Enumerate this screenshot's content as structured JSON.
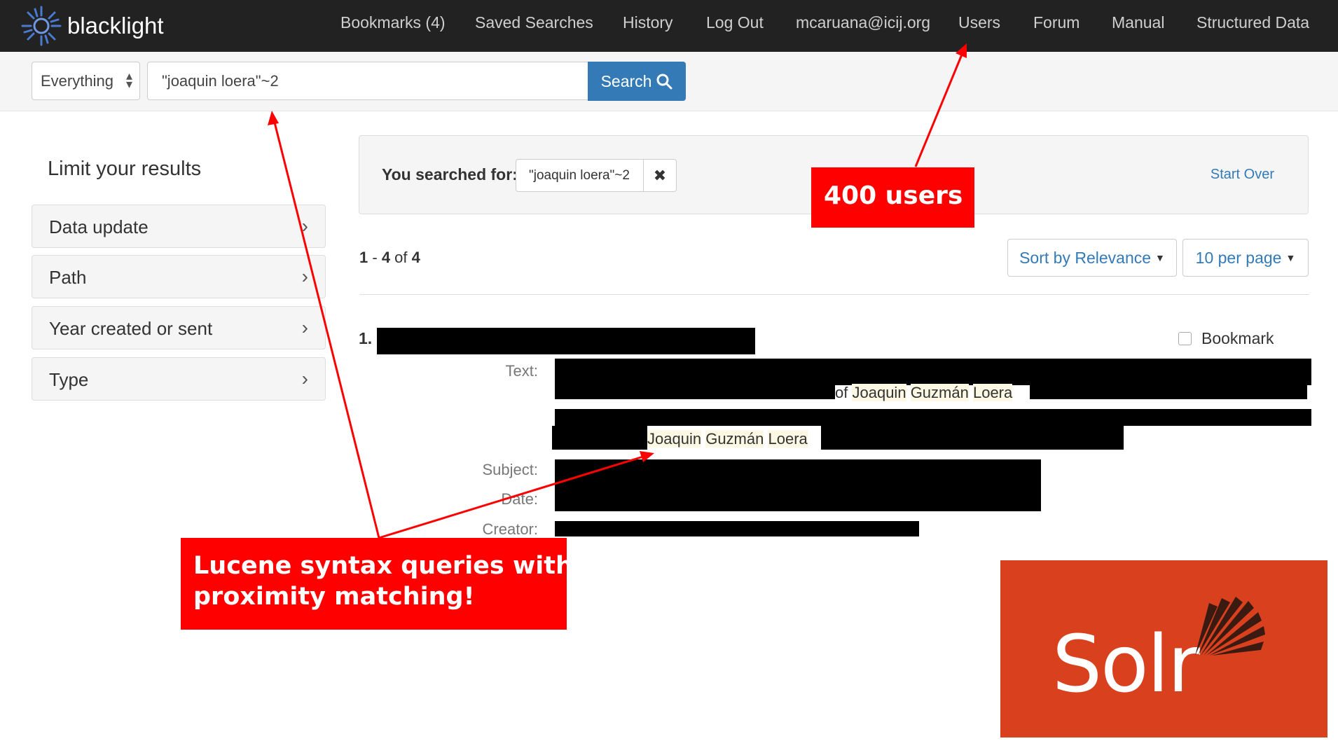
{
  "app": {
    "brand": "blacklight"
  },
  "nav": [
    "Bookmarks (4)",
    "Saved Searches",
    "History",
    "Log Out",
    "mcaruana@icij.org",
    "Users",
    "Forum",
    "Manual",
    "Structured Data"
  ],
  "search": {
    "scope": "Everything",
    "query": "\"joaquin loera\"~2",
    "button": "Search"
  },
  "sidebar": {
    "title": "Limit your results",
    "facets": [
      "Data update",
      "Path",
      "Year created or sent",
      "Type"
    ]
  },
  "constraints": {
    "label": "You searched for:",
    "value": "\"joaquin loera\"~2",
    "start_over": "Start Over"
  },
  "results": {
    "range_start": "1",
    "range_end": "4",
    "total": "4",
    "sort_label": "Sort by Relevance",
    "per_page_label": "10 per page",
    "doc_number": "1.",
    "bookmark_label": "Bookmark",
    "labels": {
      "text": "Text:",
      "subject": "Subject:",
      "date": "Date:",
      "creator": "Creator:"
    },
    "snippet1": {
      "pre": "of",
      "w1": "Joaquin",
      "w2": "Guzmán",
      "w3": "Loera"
    },
    "snippet2": {
      "w1": "Joaquin",
      "w2": "Guzmán",
      "w3": "Loera"
    }
  },
  "annotations": {
    "users_callout": "400 users",
    "lucene_callout_line1": "Lucene syntax queries with",
    "lucene_callout_line2": "proximity matching!",
    "color": "#ff0000"
  },
  "logo": {
    "text": "Solr",
    "bg": "#d9411e"
  }
}
